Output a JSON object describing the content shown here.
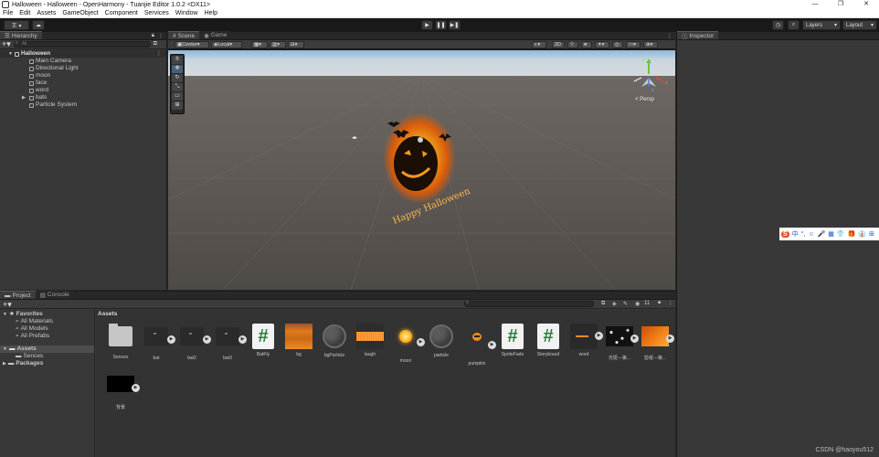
{
  "window": {
    "title": "Halloween - Halloween - OpenHarmony - Tuanjie Editor 1.0.2 <DX11>",
    "controls": [
      "—",
      "❐",
      "✕"
    ]
  },
  "menu": [
    "File",
    "Edit",
    "Assets",
    "GameObject",
    "Component",
    "Services",
    "Window",
    "Help"
  ],
  "toolbar": {
    "account_label": "王 ▾",
    "layers_label": "Layers",
    "layout_label": "Layout"
  },
  "hierarchy": {
    "tab": "Hierarchy",
    "search_placeholder": "All",
    "root": "Halloween",
    "items": [
      "Main Camera",
      "Directional Light",
      "moon",
      "face",
      "word",
      "bats",
      "Particle System"
    ]
  },
  "scene": {
    "tabs": [
      "Scene",
      "Game"
    ],
    "pivot_label": "Center",
    "space_label": "Local",
    "mode_2d": "2D",
    "gizmo_label": "< Persp",
    "gizmo_axes": [
      "y",
      "x",
      "z"
    ],
    "text_on_pumpkin": "Happy Halloween"
  },
  "inspector": {
    "tab": "Inspector"
  },
  "project": {
    "tabs": [
      "Project",
      "Console"
    ],
    "favorites_title": "Favorites",
    "favorites": [
      "All Materials",
      "All Models",
      "All Prefabs"
    ],
    "assets_title": "Assets",
    "assets_children": [
      "Sences"
    ],
    "packages_label": "Packages",
    "breadcrumb": "Assets",
    "hidden_count": "11",
    "assets": [
      {
        "name": "Sences",
        "kind": "folder"
      },
      {
        "name": "bat",
        "kind": "model"
      },
      {
        "name": "bat2",
        "kind": "model"
      },
      {
        "name": "bat3",
        "kind": "model"
      },
      {
        "name": "BatFly",
        "kind": "script"
      },
      {
        "name": "bg",
        "kind": "texture"
      },
      {
        "name": "bgParticle",
        "kind": "material"
      },
      {
        "name": "laugh",
        "kind": "audio"
      },
      {
        "name": "moon",
        "kind": "moon"
      },
      {
        "name": "particle",
        "kind": "material"
      },
      {
        "name": "pumpkin",
        "kind": "pumpkin"
      },
      {
        "name": "SpriteFade",
        "kind": "script"
      },
      {
        "name": "Storyboard",
        "kind": "script"
      },
      {
        "name": "word",
        "kind": "word"
      },
      {
        "name": "光斑---第...",
        "kind": "stars"
      },
      {
        "name": "剪纸---第...",
        "kind": "orange"
      },
      {
        "name": "背景",
        "kind": "black"
      }
    ]
  },
  "ime_toolbar": [
    "S",
    "中",
    "°,",
    "☺",
    "🎤",
    "▦",
    "👕",
    "🎁",
    "👔",
    "⊞"
  ],
  "watermark": "CSDN @haoyou512"
}
